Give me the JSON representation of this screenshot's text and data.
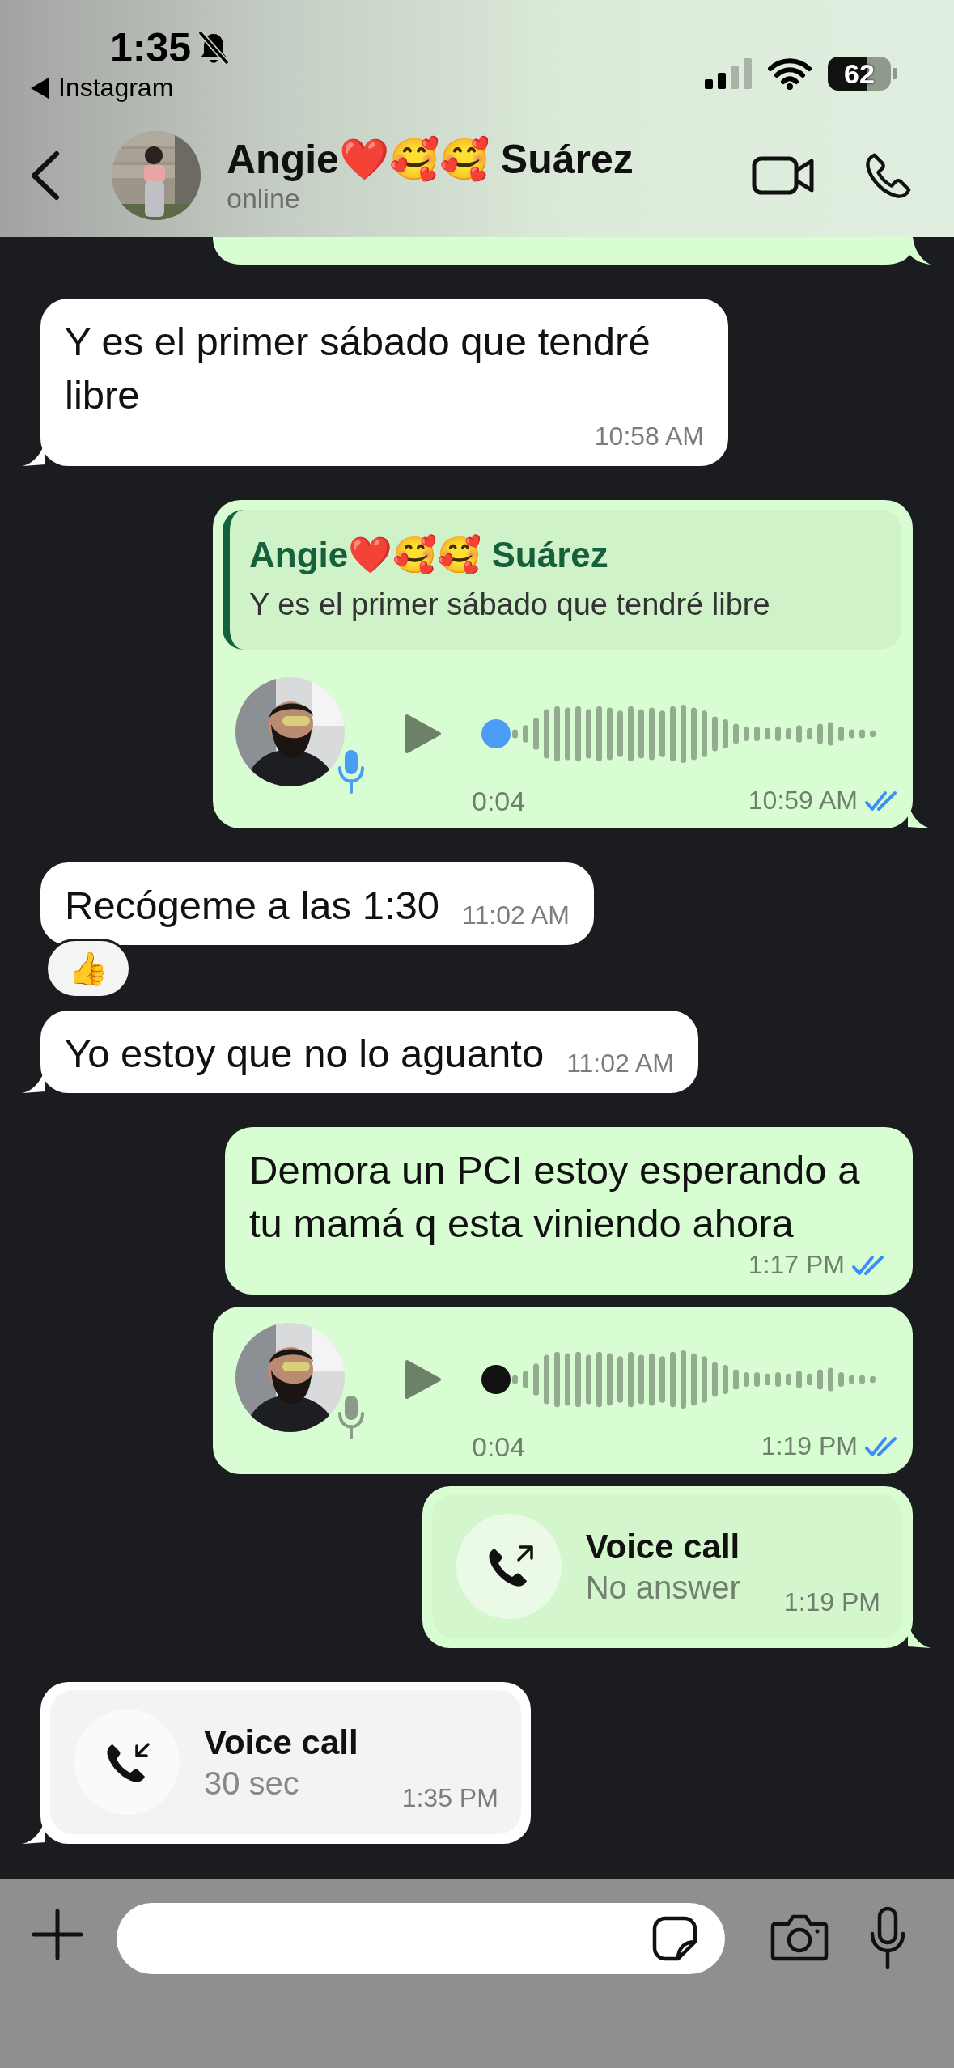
{
  "status_bar": {
    "time": "1:35",
    "silent": true,
    "back_app": "Instagram",
    "battery": "62"
  },
  "header": {
    "name": "Angie❤️🥰🥰 Suárez",
    "status": "online"
  },
  "messages": [
    {
      "kind": "partial",
      "incoming": false,
      "tail": true
    },
    {
      "kind": "text",
      "incoming": true,
      "text": "Y es el primer sábado que tendré libre",
      "time": "10:58 AM",
      "tail": true
    },
    {
      "kind": "voice",
      "incoming": false,
      "reply": {
        "author": "Angie❤️🥰🥰 Suárez",
        "text": "Y es el primer sábado que tendré libre"
      },
      "duration": "0:04",
      "time": "10:59 AM",
      "played": true,
      "read": true,
      "tail": true
    },
    {
      "kind": "text",
      "incoming": true,
      "text": "Recógeme a las 1:30",
      "time": "11:02 AM",
      "tail": false,
      "reaction": "👍"
    },
    {
      "kind": "text",
      "incoming": true,
      "text": "Yo estoy que no lo aguanto",
      "time": "11:02 AM",
      "tail": true
    },
    {
      "kind": "text",
      "incoming": false,
      "text": "Demora un PCI estoy esperando a tu mamá q esta viniendo ahora",
      "time": "1:17 PM",
      "read": true,
      "tail": false
    },
    {
      "kind": "voice",
      "incoming": false,
      "duration": "0:04",
      "time": "1:19 PM",
      "played": false,
      "read": true,
      "tail": false
    },
    {
      "kind": "call",
      "incoming": false,
      "title": "Voice call",
      "detail": "No answer",
      "time": "1:19 PM",
      "tail": true
    },
    {
      "kind": "call",
      "incoming": true,
      "title": "Voice call",
      "detail": "30 sec",
      "time": "1:35 PM",
      "tail": true
    }
  ]
}
